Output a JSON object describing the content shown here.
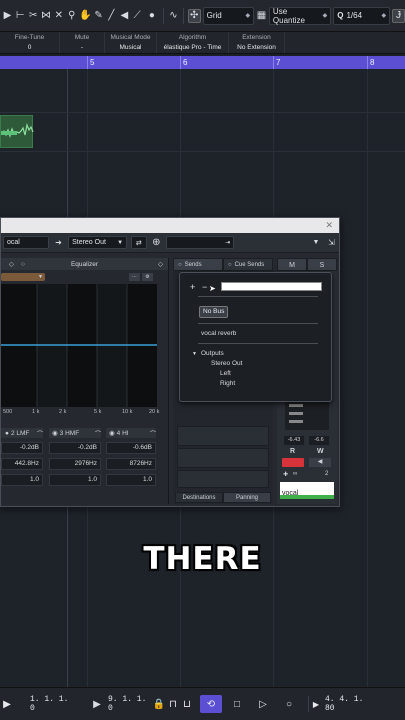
{
  "toolbar": {
    "snap_value": "Grid",
    "quantize_value": "Use Quantize",
    "grid_value": "1/64",
    "q_label": "Q"
  },
  "infoline": {
    "columns": [
      {
        "header": "Fine-Tune",
        "value": "0"
      },
      {
        "header": "Mute",
        "value": "-"
      },
      {
        "header": "Musical Mode",
        "value": "Musical"
      },
      {
        "header": "Algorithm",
        "value": "élastique Pro - Time"
      },
      {
        "header": "Extension",
        "value": "No Extension"
      }
    ]
  },
  "ruler": {
    "marks": [
      "5",
      "6",
      "7",
      "8"
    ]
  },
  "channel_window": {
    "channel_name": "ocal",
    "output": "Stereo Out",
    "eq_title": "Equalizer",
    "freq_labels": [
      "500",
      "1 k",
      "2 k",
      "5 k",
      "10 k",
      "20 k"
    ],
    "bands": [
      {
        "name": "2 LMF",
        "gain": "-0.2dB",
        "freq": "442.8Hz",
        "q": "1.0"
      },
      {
        "name": "3 HMF",
        "gain": "-0.2dB",
        "freq": "2976Hz",
        "q": "1.0"
      },
      {
        "name": "4 HI",
        "gain": "-0.6dB",
        "freq": "8726Hz",
        "q": "1.0"
      }
    ],
    "sends_tab": "Sends",
    "cue_sends_tab": "Cue Sends",
    "destinations_tab": "Destinations",
    "panning_tab": "Panning",
    "m_label": "M",
    "s_label": "S",
    "meter_left": "-6.43",
    "meter_right": "-6.6",
    "r_label": "R",
    "w_label": "W",
    "channel_number": "2",
    "strip_name": "vocal"
  },
  "send_popup": {
    "no_bus": "No Bus",
    "vocal_reverb": "vocal reverb",
    "outputs": "Outputs",
    "stereo_out": "Stereo Out",
    "left": "Left",
    "right": "Right"
  },
  "caption": "THERE",
  "transport": {
    "left_locator": "1. 1. 1.  0",
    "right_locator": "9. 1. 1.  0",
    "position": "4. 4. 1. 80"
  },
  "colors": {
    "ruler": "#5c4fd4",
    "eq_curve": "#3aa0d8",
    "record_red": "#d8323a",
    "loop_active": "#5c4fd4"
  }
}
